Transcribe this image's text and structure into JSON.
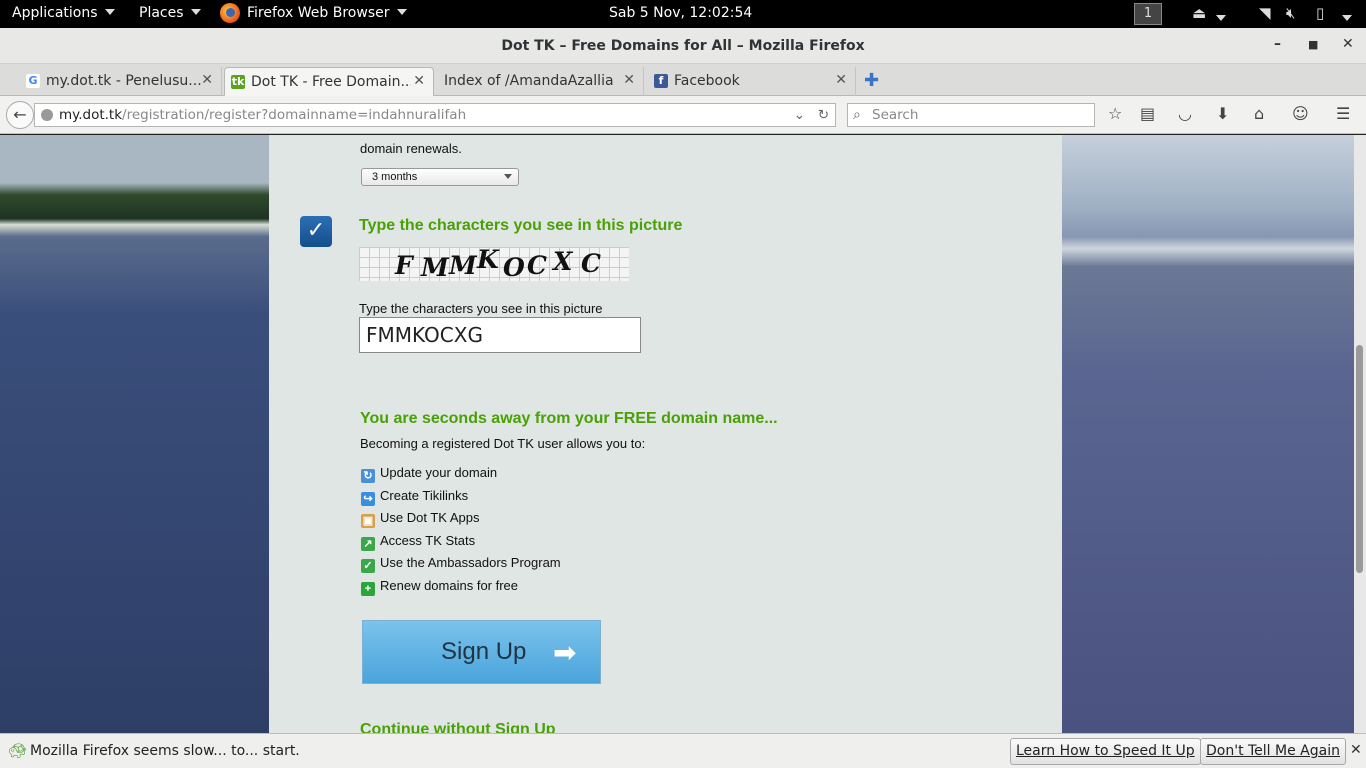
{
  "topbar": {
    "applications": "Applications",
    "places": "Places",
    "app_name": "Firefox Web Browser",
    "clock": "Sab  5 Nov, 12:02:54",
    "workspace": "1"
  },
  "window": {
    "title": "Dot TK – Free Domains for All – Mozilla Firefox"
  },
  "tabs": [
    {
      "label": "my.dot.tk - Penelusu...",
      "icon": "google-icon",
      "active": false
    },
    {
      "label": "Dot TK - Free Domain...",
      "icon": "dottk-icon",
      "active": true
    },
    {
      "label": "Index of /AmandaAzallia",
      "icon": "",
      "active": false
    },
    {
      "label": "Facebook",
      "icon": "facebook-icon",
      "active": false
    }
  ],
  "navbar": {
    "url_host": "my.dot.tk",
    "url_path": "/registration/register?domainname=indahnuralifah",
    "search_placeholder": "Search"
  },
  "page": {
    "renewal_text": "domain renewals.",
    "renewal_select": "3 months",
    "captcha_heading": "Type the characters you see in this picture",
    "captcha_chars": [
      "F",
      "M",
      "M",
      "K",
      "O",
      "C",
      "X",
      "C"
    ],
    "captcha_label": "Type the characters you see in this picture",
    "captcha_value": "FMMKOCXG",
    "promo_heading": "You are seconds away from your FREE domain name...",
    "promo_sub": "Becoming a registered Dot TK user allows you to:",
    "benefits": [
      {
        "label": "Update your domain",
        "icon": "update-icon",
        "color": "#4a8fd8"
      },
      {
        "label": "Create Tikilinks",
        "icon": "link-arrow-icon",
        "color": "#3a8ee0"
      },
      {
        "label": "Use Dot TK Apps",
        "icon": "apps-box-icon",
        "color": "#d9a04a"
      },
      {
        "label": "Access TK Stats",
        "icon": "stats-chart-icon",
        "color": "#3aa84a"
      },
      {
        "label": "Use the Ambassadors Program",
        "icon": "shield-check-icon",
        "color": "#3aa84a"
      },
      {
        "label": "Renew domains for free",
        "icon": "plus-icon",
        "color": "#2ca53a"
      }
    ],
    "signup_label": "Sign Up",
    "continue_label": "Continue without Sign Up"
  },
  "notification": {
    "message": "Mozilla Firefox seems slow... to... start.",
    "learn_button": "Learn How to Speed It Up",
    "dismiss_button": "Don't Tell Me Again"
  },
  "colors": {
    "accent_green": "#4aa007",
    "panel_bg": "#e0e6e3",
    "signup_blue": "#5ab2e4"
  }
}
